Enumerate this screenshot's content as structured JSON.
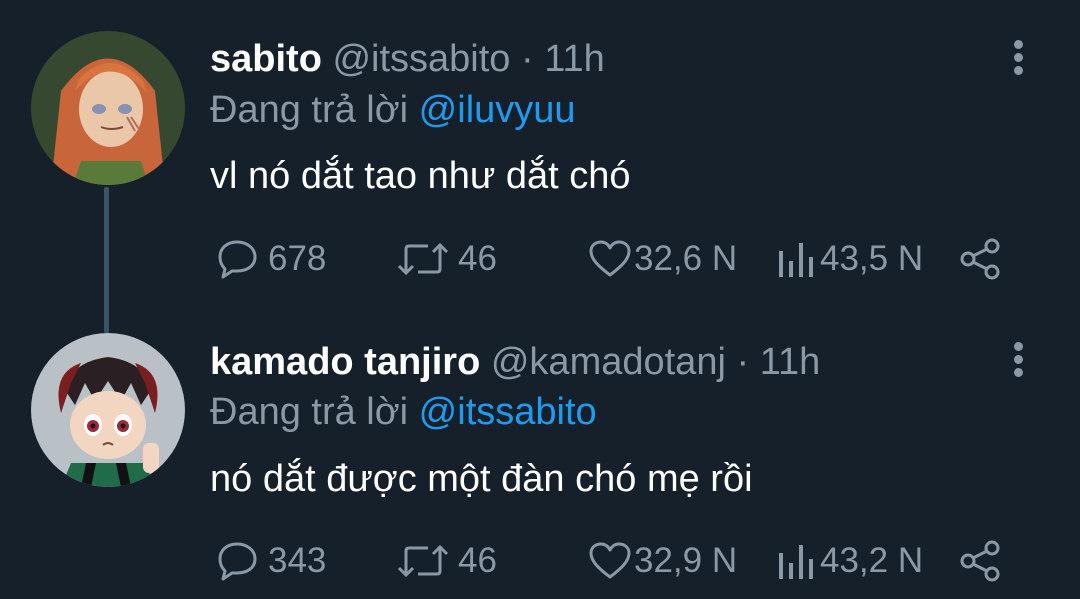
{
  "tweets": [
    {
      "name": "sabito",
      "handle": "@itssabito",
      "separator": "·",
      "time": "11h",
      "reply_prefix": "Đang trả lời",
      "reply_mention": "@iluvyuu",
      "text": "vl nó dắt tao như dắt chó",
      "replies": "678",
      "retweets": "46",
      "likes": "32,6 N",
      "views": "43,5 N"
    },
    {
      "name": "kamado tanjiro",
      "handle": "@kamadotanj",
      "separator": "·",
      "time": "11h",
      "reply_prefix": "Đang trả lời",
      "reply_mention": "@itssabito",
      "text": "nó dắt được một đàn chó mẹ rồi",
      "replies": "343",
      "retweets": "46",
      "likes": "32,9 N",
      "views": "43,2 N"
    }
  ],
  "icons": {
    "more": "more-vertical-icon",
    "reply": "speech-bubble-icon",
    "retweet": "retweet-icon",
    "like": "heart-icon",
    "views": "bar-chart-icon",
    "share": "share-icon"
  },
  "colors": {
    "background": "#15202b",
    "text": "#ffffff",
    "muted": "#8b98a5",
    "link": "#1d9bf0",
    "thread_line": "#3d5466"
  }
}
